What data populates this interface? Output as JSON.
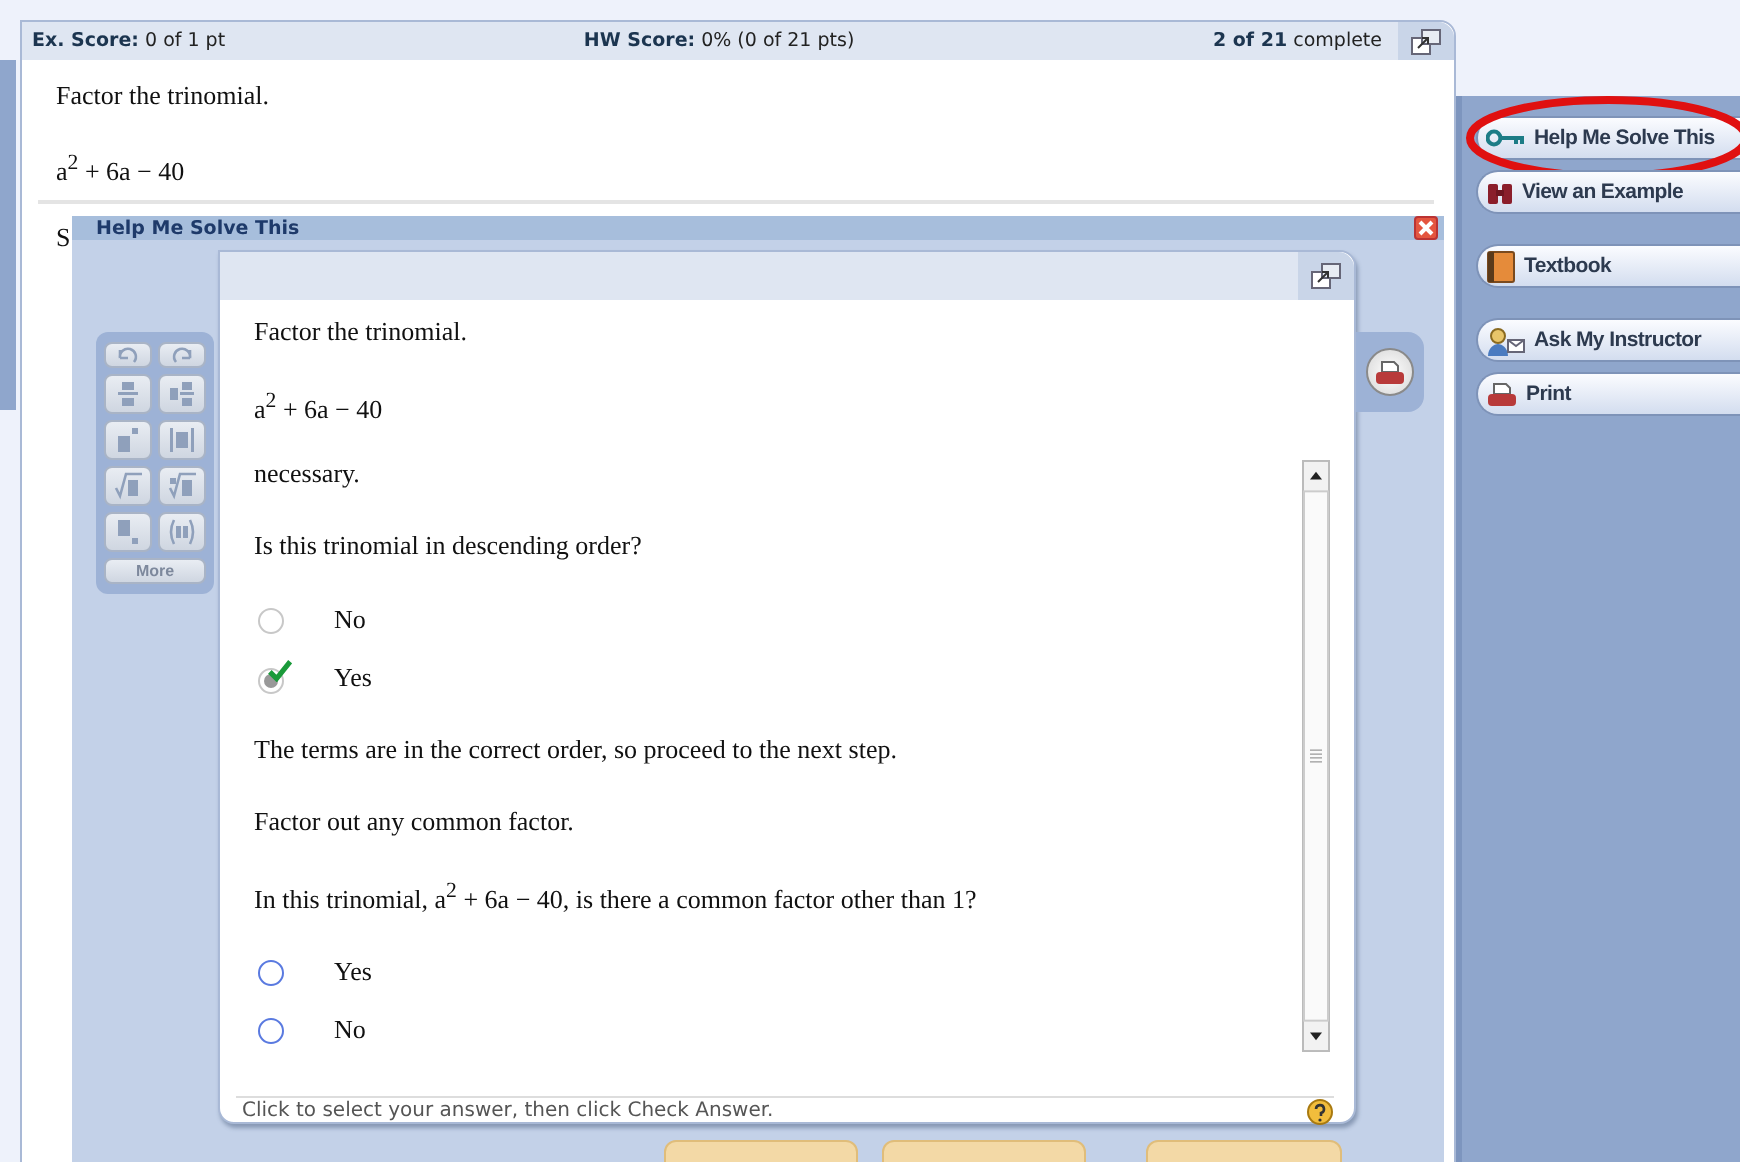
{
  "header": {
    "ex_score_label": "Ex. Score:",
    "ex_score": "0 of 1 pt",
    "hw_score_label": "HW Score:",
    "hw_score": "0% (0 of 21 pts)",
    "progress_count": "2 of 21",
    "progress_label": "complete"
  },
  "question": {
    "instruction": "Factor the trinomial.",
    "expression": "a$^{2}$ + 6a − 40",
    "prompt": "S"
  },
  "sidebar": {
    "groups": [
      [
        {
          "label": "Help Me Solve This",
          "kind": "key",
          "highlighted": true
        },
        {
          "label": "View an Example",
          "kind": "binoculars",
          "highlighted": false
        }
      ],
      [
        {
          "label": "Textbook",
          "kind": "book",
          "highlighted": false
        }
      ],
      [
        {
          "label": "Ask My Instructor",
          "kind": "instructor",
          "highlighted": false
        },
        {
          "label": "Print",
          "kind": "print",
          "highlighted": false
        }
      ]
    ]
  },
  "dialog": {
    "title": "Help Me Solve This",
    "palette": {
      "more_label": "More"
    },
    "problem": {
      "instruction": "Factor the trinomial.",
      "expression": "a$^{2}$ + 6a − 40"
    },
    "steps": [
      {
        "kind": "text",
        "text": "necessary."
      },
      {
        "kind": "text",
        "text": "Is this trinomial in descending order?"
      },
      {
        "kind": "choices",
        "answered": true,
        "choices": [
          {
            "label": "No",
            "selected": false
          },
          {
            "label": "Yes",
            "selected": true
          }
        ]
      },
      {
        "kind": "text",
        "text": "The terms are in the correct order, so proceed to the next step."
      },
      {
        "kind": "text",
        "text": "Factor out any common factor."
      },
      {
        "kind": "text",
        "text": "In this trinomial, a$^{2}$ + 6a − 40, is there a common factor other than 1?"
      },
      {
        "kind": "choices",
        "answered": false,
        "choices": [
          {
            "label": "Yes",
            "selected": false
          },
          {
            "label": "No",
            "selected": false
          }
        ]
      }
    ],
    "hint": "Click to select your answer, then click Check Answer."
  }
}
